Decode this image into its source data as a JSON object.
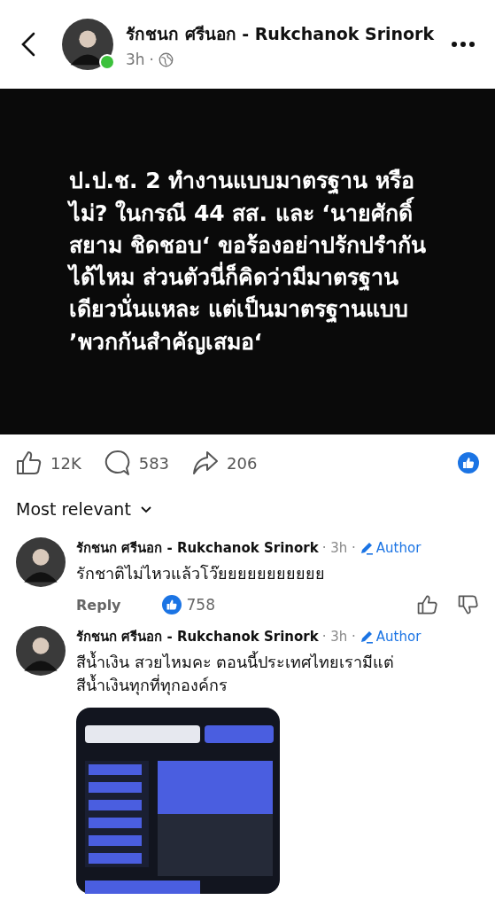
{
  "header": {
    "author": "รักชนก ศรีนอก - Rukchanok Srinork",
    "online": true,
    "time": "3h",
    "separator": "·"
  },
  "post": {
    "lines": [
      "ป.ป.ช. 2 ทำงานแบบมาตรฐาน หรือ",
      "ไม่? ในกรณี 44 สส. และ ‘นายศักดิ์",
      "สยาม ชิดชอบ‘ ขอร้องอย่าปรักปรำกัน",
      "ได้ไหม ส่วนตัวนี่ก็คิดว่ามีมาตรฐาน",
      "เดียวนั่นแหละ แต่เป็นมาตรฐานแบบ",
      "’พวกกันสำคัญเสมอ‘"
    ]
  },
  "stats": {
    "likes": "12K",
    "comments": "583",
    "shares": "206"
  },
  "sort": {
    "label": "Most relevant"
  },
  "comments": [
    {
      "author": "รักชนก ศรีนอก - Rukchanok Srinork",
      "time": "· 3h ·",
      "badge": "Author",
      "text": [
        "รักชาติไม่ไหวแล้วโว๊ยยยยยยยยยยย"
      ],
      "reply": "Reply",
      "likes": "758"
    },
    {
      "author": "รักชนก ศรีนอก - Rukchanok Srinork",
      "time": "· 3h ·",
      "badge": "Author",
      "text": [
        "สีน้ำเงิน สวยไหมคะ ตอนนี้ประเทศไทยเรามีแต่",
        "สีน้ำเงินทุกที่ทุกองค์กร"
      ]
    }
  ]
}
